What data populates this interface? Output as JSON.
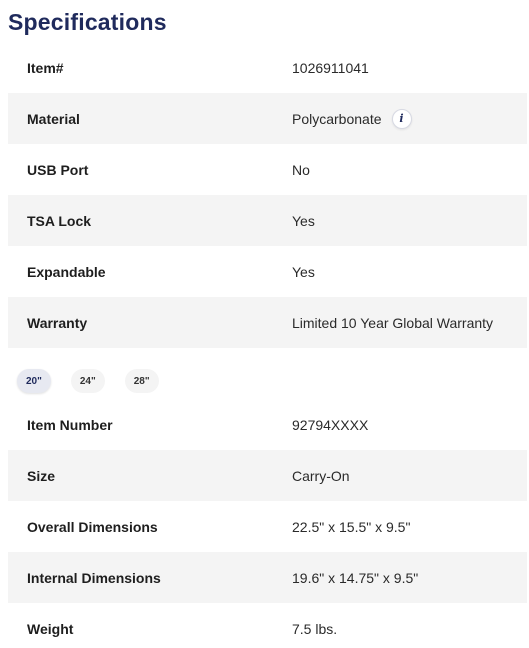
{
  "title": "Specifications",
  "general_specs": [
    {
      "label": "Item#",
      "value": "1026911041"
    },
    {
      "label": "Material",
      "value": "Polycarbonate",
      "info_icon": "info-icon"
    },
    {
      "label": "USB Port",
      "value": "No"
    },
    {
      "label": "TSA Lock",
      "value": "Yes"
    },
    {
      "label": "Expandable",
      "value": "Yes"
    },
    {
      "label": "Warranty",
      "value": "Limited 10 Year Global Warranty"
    }
  ],
  "info_icon_glyph": "i",
  "size_tabs": [
    {
      "label": "20\"",
      "active": true
    },
    {
      "label": "24\"",
      "active": false
    },
    {
      "label": "28\"",
      "active": false
    }
  ],
  "size_specs": [
    {
      "label": "Item Number",
      "value": "92794XXXX"
    },
    {
      "label": "Size",
      "value": "Carry-On"
    },
    {
      "label": "Overall Dimensions",
      "value": "22.5\" x 15.5\" x 9.5\""
    },
    {
      "label": "Internal Dimensions",
      "value": "19.6\" x 14.75\" x 9.5\""
    },
    {
      "label": "Weight",
      "value": "7.5 lbs."
    }
  ],
  "colors": {
    "title": "#1f2a5c",
    "row_shade": "#f4f4f4",
    "active_tab": "#e7e9f1"
  }
}
